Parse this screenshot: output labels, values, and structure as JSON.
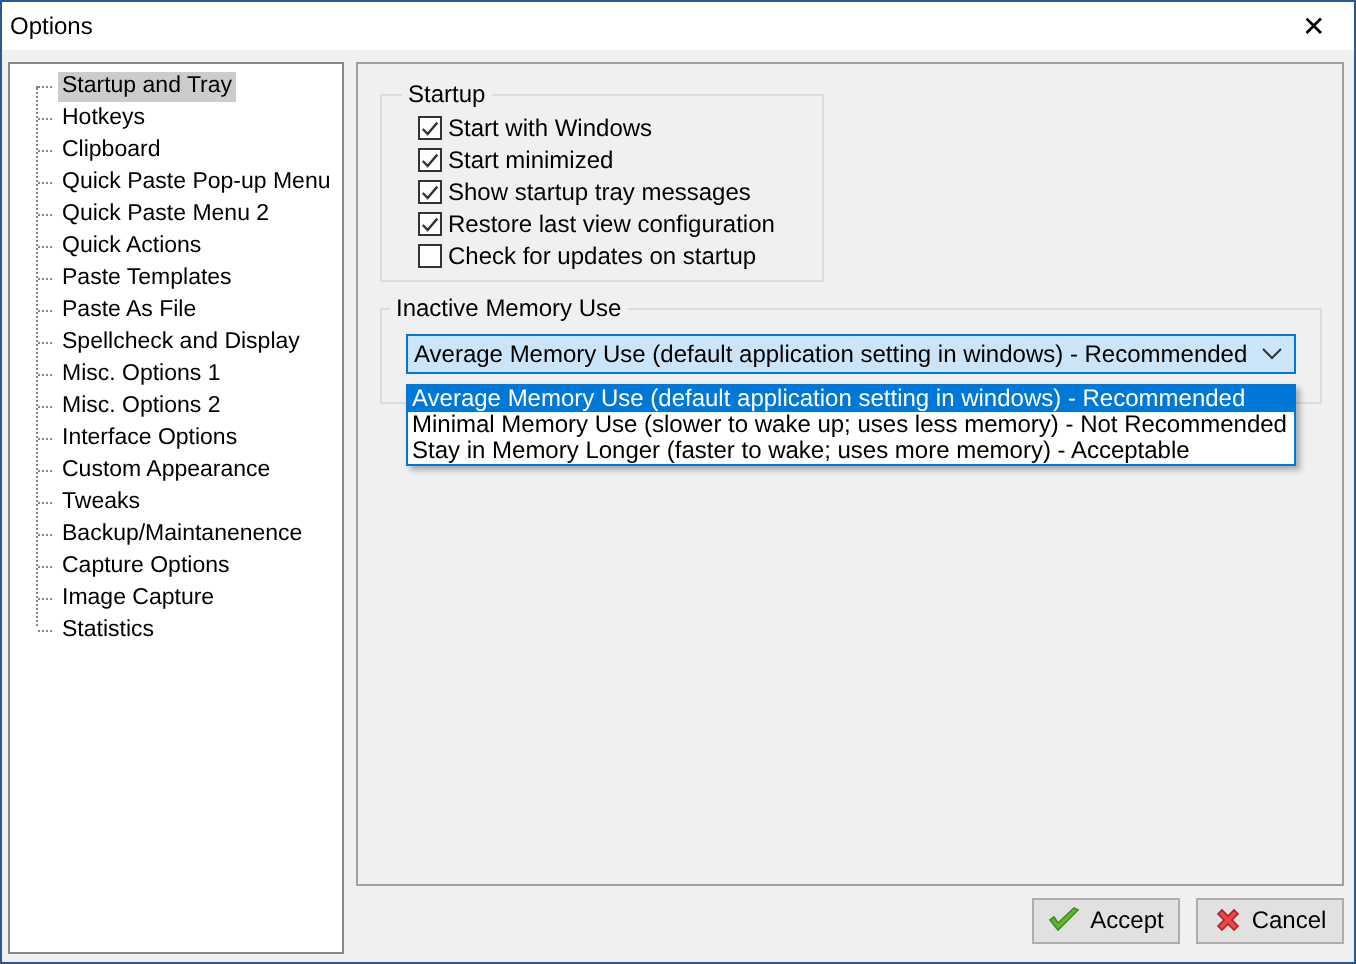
{
  "window": {
    "title": "Options",
    "close": "✕"
  },
  "tree": {
    "items": [
      {
        "label": "Startup and Tray",
        "selected": true
      },
      {
        "label": "Hotkeys",
        "selected": false
      },
      {
        "label": "Clipboard",
        "selected": false
      },
      {
        "label": "Quick Paste Pop-up Menu",
        "selected": false
      },
      {
        "label": "Quick Paste Menu 2",
        "selected": false
      },
      {
        "label": "Quick Actions",
        "selected": false
      },
      {
        "label": "Paste Templates",
        "selected": false
      },
      {
        "label": "Paste As File",
        "selected": false
      },
      {
        "label": "Spellcheck and Display",
        "selected": false
      },
      {
        "label": "Misc. Options 1",
        "selected": false
      },
      {
        "label": "Misc. Options 2",
        "selected": false
      },
      {
        "label": "Interface Options",
        "selected": false
      },
      {
        "label": "Custom Appearance",
        "selected": false
      },
      {
        "label": "Tweaks",
        "selected": false
      },
      {
        "label": "Backup/Maintanenence",
        "selected": false
      },
      {
        "label": "Capture Options",
        "selected": false
      },
      {
        "label": "Image Capture",
        "selected": false
      },
      {
        "label": "Statistics",
        "selected": false
      }
    ]
  },
  "startup": {
    "title": "Startup",
    "options": [
      {
        "label": "Start with Windows",
        "checked": true
      },
      {
        "label": "Start minimized",
        "checked": true
      },
      {
        "label": "Show startup tray messages",
        "checked": true
      },
      {
        "label": "Restore last view configuration",
        "checked": true
      },
      {
        "label": "Check for updates on startup",
        "checked": false
      }
    ]
  },
  "memory": {
    "title": "Inactive Memory Use",
    "value": "Average Memory Use (default application setting in windows) - Recommended",
    "expanded": true,
    "options": [
      {
        "label": "Average Memory Use (default application setting in windows) - Recommended",
        "selected": true
      },
      {
        "label": "Minimal Memory Use (slower to wake up; uses less memory) - Not Recommended",
        "selected": false
      },
      {
        "label": "Stay in Memory Longer (faster to wake; uses more memory) - Acceptable",
        "selected": false
      }
    ]
  },
  "buttons": [
    {
      "label": "Accept",
      "kind": "accept"
    },
    {
      "label": "Cancel",
      "kind": "cancel"
    }
  ]
}
